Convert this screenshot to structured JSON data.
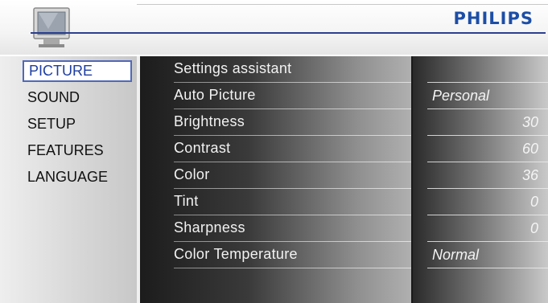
{
  "header": {
    "brand": "PHILIPS",
    "icon": "tv-icon"
  },
  "left_menu": {
    "items": [
      {
        "label": "PICTURE",
        "active": true
      },
      {
        "label": "SOUND",
        "active": false
      },
      {
        "label": "SETUP",
        "active": false
      },
      {
        "label": "FEATURES",
        "active": false
      },
      {
        "label": "LANGUAGE",
        "active": false
      }
    ]
  },
  "picture_menu": {
    "rows": [
      {
        "label": "Settings assistant",
        "value": ""
      },
      {
        "label": "Auto Picture",
        "value": "Personal"
      },
      {
        "label": "Brightness",
        "value": "30"
      },
      {
        "label": "Contrast",
        "value": "60"
      },
      {
        "label": "Color",
        "value": "36"
      },
      {
        "label": "Tint",
        "value": "0"
      },
      {
        "label": "Sharpness",
        "value": "0"
      },
      {
        "label": "Color Temperature",
        "value": "Normal"
      }
    ]
  },
  "colors": {
    "brand": "#1d4ea6",
    "accent_line": "#2a3f8f",
    "highlight_border": "#5068b8"
  }
}
